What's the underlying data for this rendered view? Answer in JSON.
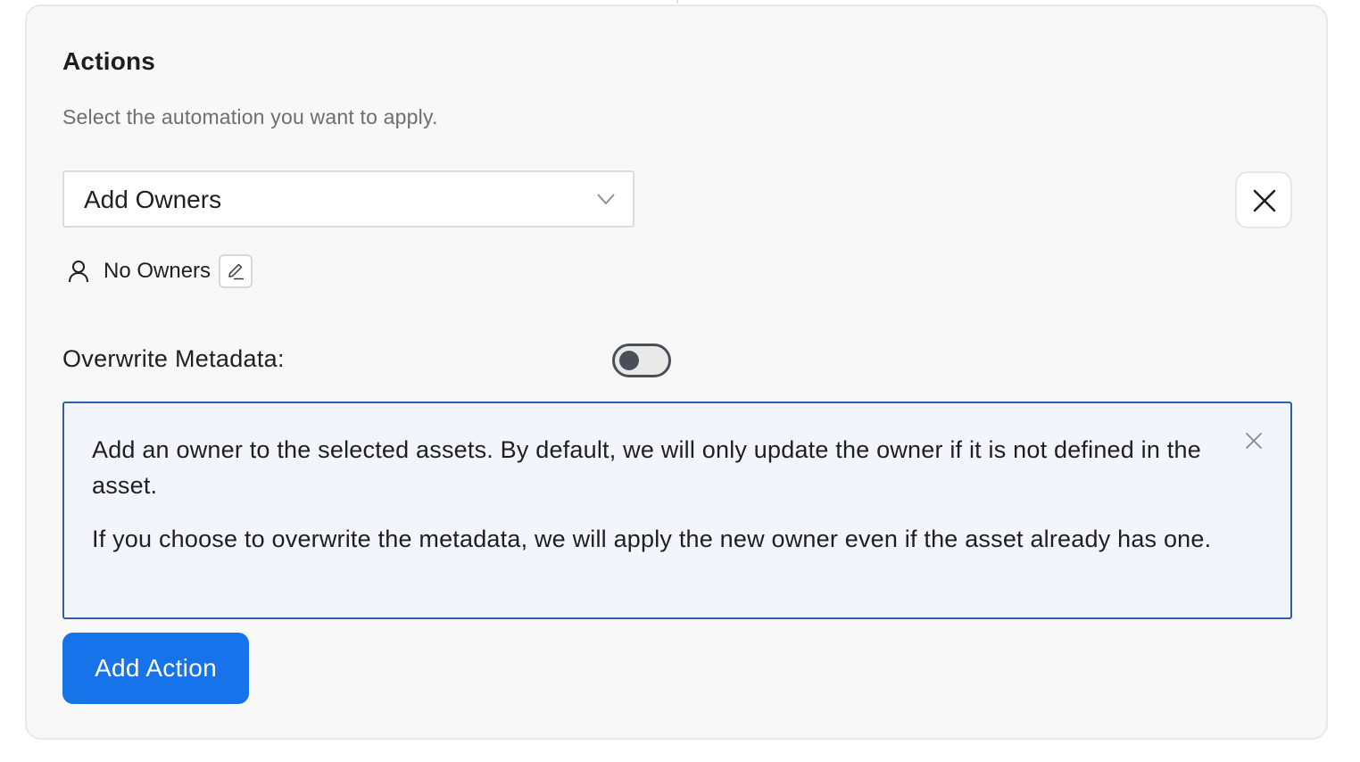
{
  "actions": {
    "title": "Actions",
    "subtitle": "Select the automation you want to apply.",
    "action_select": {
      "value": "Add Owners"
    },
    "owners": {
      "label": "No Owners"
    },
    "overwrite": {
      "label": "Overwrite Metadata:",
      "enabled": false
    },
    "info": {
      "paragraph1": "Add an owner to the selected assets. By default, we will only update the owner if it is not defined in the asset.",
      "paragraph2": "If you choose to overwrite the metadata, we will apply the new owner even if the asset already has one."
    },
    "add_action_label": "Add Action"
  },
  "colors": {
    "primary": "#1673ea",
    "info_border": "#2e5fa8",
    "info_background": "#f2f6fc",
    "card_background": "#f8f8f8"
  },
  "icons": [
    "chevron-down-icon",
    "close-icon",
    "user-icon",
    "pencil-icon",
    "dismiss-icon"
  ]
}
